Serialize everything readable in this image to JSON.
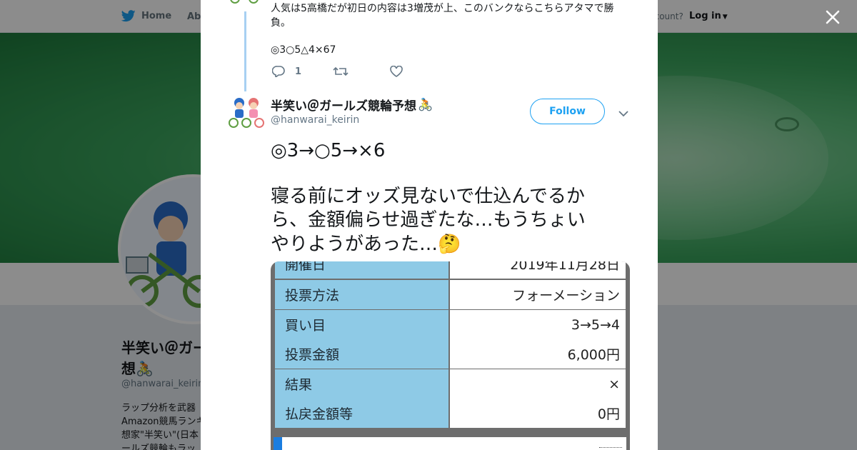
{
  "nav": {
    "home_label": "Home",
    "about_label": "Abo",
    "account_text": "ccount?",
    "login_label": "Log in"
  },
  "profile": {
    "name_line1": "半笑い＠ガー",
    "name_line2": "想",
    "handle": "@hanwarai_keirin",
    "bio_lines": [
      "ラップ分析を武器",
      "Amazon競馬ランキ",
      "想家\"半笑い\"(日本",
      "ールズ競輪もラッ"
    ]
  },
  "previous_tweet": {
    "text": "人気は5高橋だが初日の内容は3増茂が上、このバンクならこちらアタマで勝負。",
    "marks": "◎3○5△4×67",
    "reply_count": "1",
    "retweet_count": "",
    "like_count": ""
  },
  "tweet": {
    "author_name": "半笑い＠ガールズ競輪予想",
    "author_handle": "@hanwarai_keirin",
    "follow_label": "Follow",
    "lines": [
      "◎3→○5→×6",
      "",
      "寝る前にオッズ見ないで仕込んでるか",
      "ら、金額偏らせ過ぎたな…もうちょい",
      "やりようがあった…"
    ]
  },
  "ticket_table": {
    "rows": [
      {
        "label": "開催日",
        "value": "2019年11月28日"
      },
      {
        "label": "投票方法",
        "value": "フォーメーション"
      },
      {
        "label": "買い目",
        "value": "3→5→4"
      },
      {
        "label": "投票金額",
        "value": "6,000円"
      },
      {
        "label": "結果",
        "value": "×"
      },
      {
        "label": "払戻金額等",
        "value": "0円"
      }
    ]
  },
  "colors": {
    "accent": "#1da1f2",
    "thread_line": "#a7d0f2",
    "table_label_bg": "#8ecae6",
    "banner_green": "#3aa35c"
  },
  "icons": [
    "twitter-bird-icon",
    "close-icon",
    "reply-icon",
    "retweet-icon",
    "like-icon",
    "chevron-down-icon",
    "bicycle-emoji-icon",
    "thinking-face-emoji-icon"
  ]
}
